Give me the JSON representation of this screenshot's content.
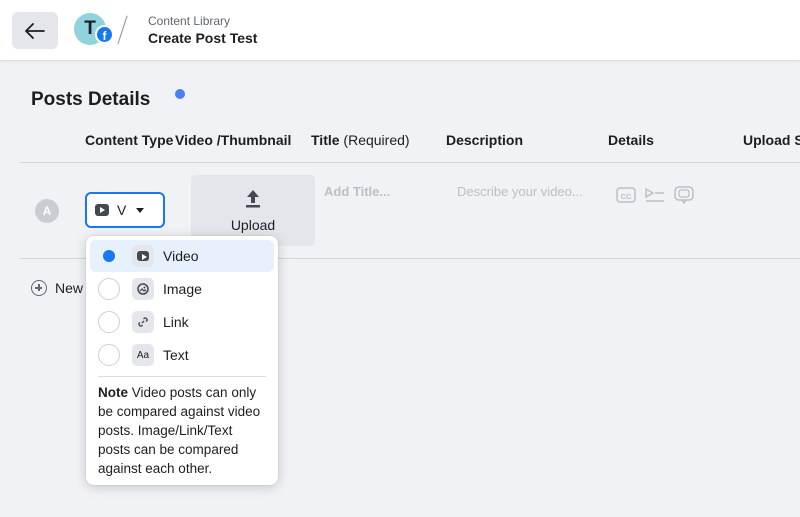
{
  "header": {
    "back_icon": "arrow-left-icon",
    "avatar_letter": "T",
    "badge_letter": "f",
    "breadcrumb_parent": "Content Library",
    "page_title": "Create Post Test"
  },
  "section": {
    "title": "Posts Details"
  },
  "columns": {
    "content_type": "Content Type",
    "video_thumbnail": "Video /Thumbnail",
    "title_main": "Title",
    "title_suffix": "(Required)",
    "description": "Description",
    "details": "Details",
    "upload_status": "Upload St"
  },
  "row": {
    "badge": "A",
    "selected_type": "V",
    "upload_label": "Upload",
    "title_placeholder": "Add Title...",
    "description_placeholder": "Describe your video...",
    "detail_icons": [
      "closed-captions-icon",
      "playlist-icon",
      "chat-bubble-icon"
    ]
  },
  "new_button": "New",
  "dropdown": {
    "options": [
      {
        "label": "Video",
        "icon": "video-icon",
        "selected": true
      },
      {
        "label": "Image",
        "icon": "image-icon",
        "selected": false
      },
      {
        "label": "Link",
        "icon": "link-icon",
        "selected": false
      },
      {
        "label": "Text",
        "icon": "text-icon",
        "icon_text": "Aa",
        "selected": false
      }
    ],
    "note_bold": "Note",
    "note_text": " Video posts can only be compared against video posts. Image/Link/Text posts can be compared against each other."
  },
  "colors": {
    "accent": "#1877f2",
    "background": "#f0f2f5",
    "placeholder": "#bcc0c4"
  }
}
